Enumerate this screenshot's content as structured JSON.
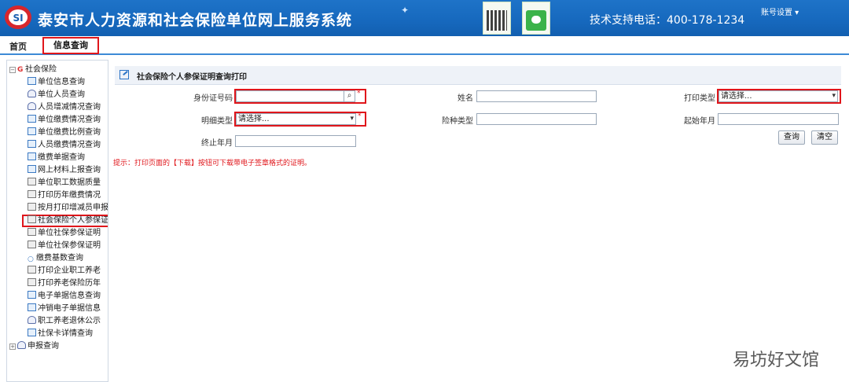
{
  "header": {
    "title": "泰安市人力资源和社会保险单位网上服务系统",
    "support": "技术支持电话：400-178-1234",
    "account": "账号设置 ▾"
  },
  "nav": {
    "home": "首页",
    "info": "信息查询"
  },
  "sidebar": {
    "root": "社会保险",
    "items": [
      "单位信息查询",
      "单位人员查询",
      "人员增减情况查询",
      "单位缴费情况查询",
      "单位缴费比例查询",
      "人员缴费情况查询",
      "缴费单据查询",
      "网上材料上报查询",
      "单位职工数据质量",
      "打印历年缴费情况",
      "按月打印增减员申报",
      "社会保险个人参保证",
      "单位社保参保证明",
      "单位社保参保证明",
      "缴费基数查询",
      "打印企业职工养老",
      "打印养老保险历年",
      "电子单据信息查询",
      "冲销电子单据信息",
      "职工养老退休公示",
      "社保卡详情查询"
    ],
    "root2": "申报查询"
  },
  "panel": {
    "title": "社会保险个人参保证明查询打印",
    "fields": {
      "idcard_label": "身份证号码",
      "name_label": "姓名",
      "print_type_label": "打印类型",
      "print_type_value": "请选择...",
      "detail_type_label": "明细类型",
      "detail_type_value": "请选择...",
      "insurance_type_label": "险种类型",
      "start_month_label": "起始年月",
      "end_month_label": "终止年月"
    },
    "buttons": {
      "query": "查询",
      "clear": "清空"
    },
    "tip": "提示：打印页面的【下载】按钮可下载带电子签章格式的证明。"
  },
  "watermark": "易坊好文馆",
  "colors": {
    "header_blue": "#1668bd",
    "highlight_red": "#e0161b"
  }
}
